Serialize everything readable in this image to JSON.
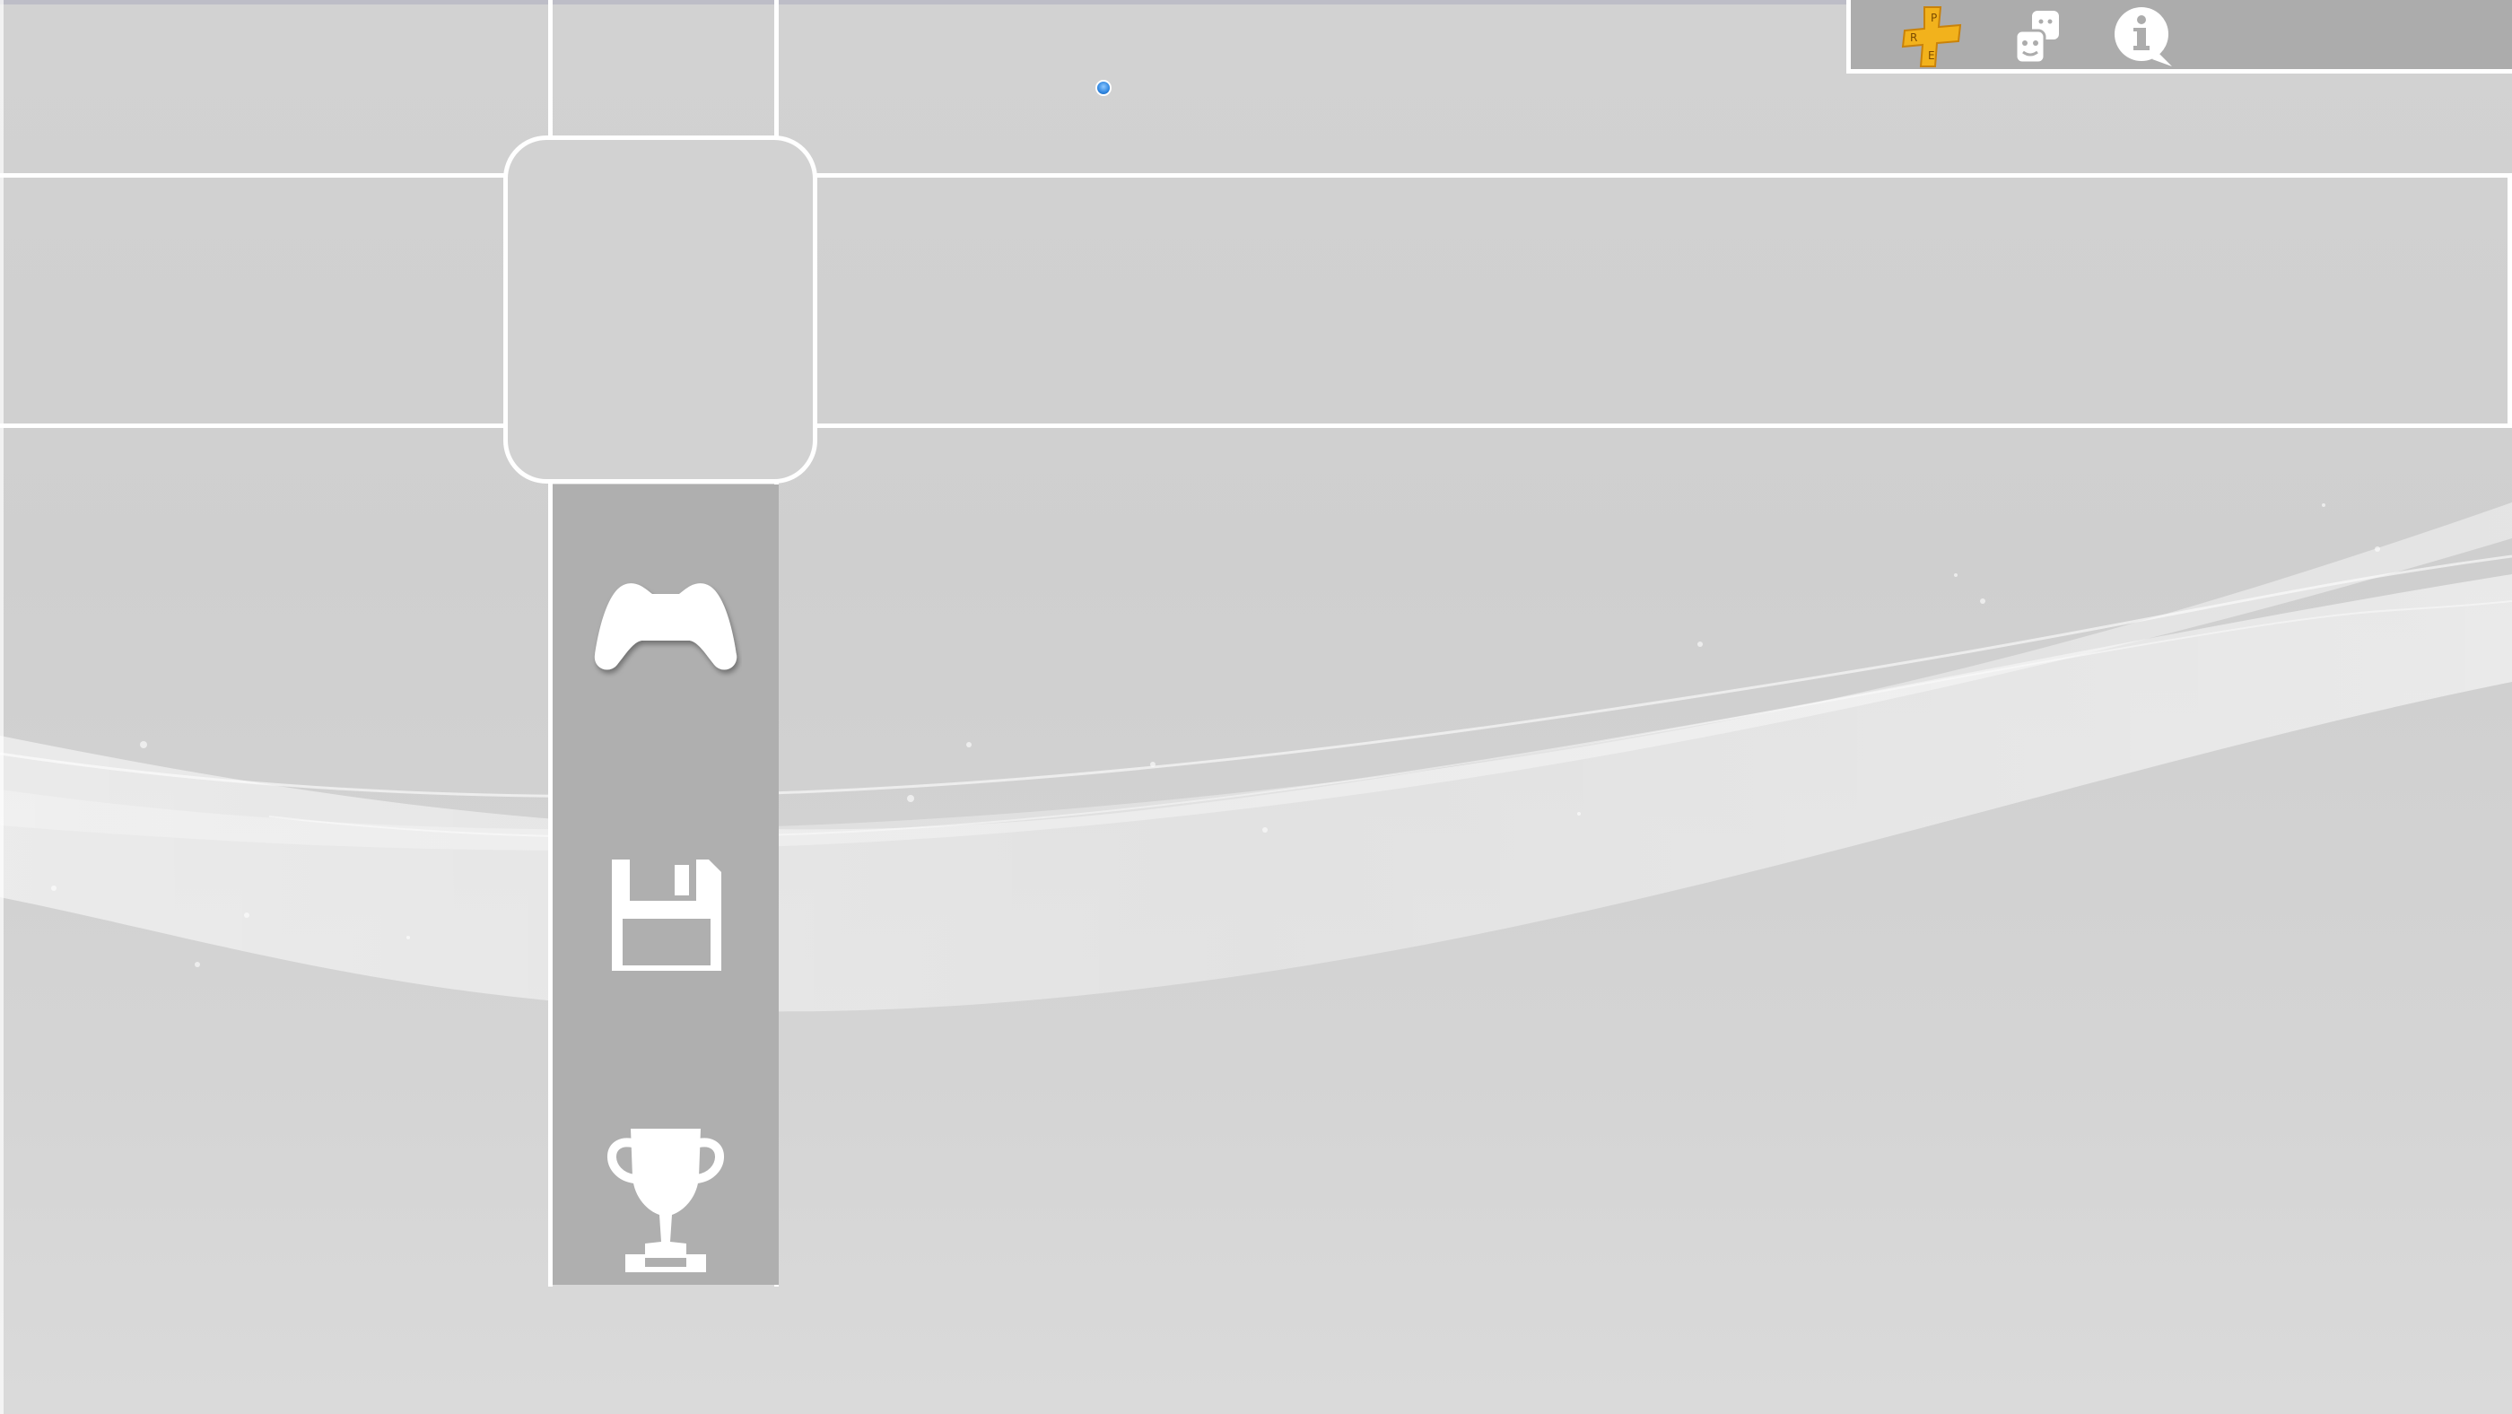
{
  "app": {
    "name": "",
    "theme": "light-grey-waves"
  },
  "colors": {
    "background": "#d2d2d2",
    "frame_lines": "#ffffff",
    "status_panel": "#acacac",
    "category_column": "#afafaf",
    "plus_badge": "#f2b21c",
    "cursor": "#2f86e0"
  },
  "status_bar": {
    "icons": [
      {
        "name": "playstation-plus-icon",
        "letters": [
          "P",
          "R",
          "E"
        ]
      },
      {
        "name": "friends-icon"
      },
      {
        "name": "information-icon"
      }
    ]
  },
  "focus_tile": {
    "state": "selected",
    "content": ""
  },
  "categories": [
    {
      "name": "game-controller-icon",
      "label": ""
    },
    {
      "name": "saved-data-icon",
      "label": ""
    },
    {
      "name": "trophy-icon",
      "label": ""
    }
  ],
  "cursor": {
    "visible": true
  }
}
